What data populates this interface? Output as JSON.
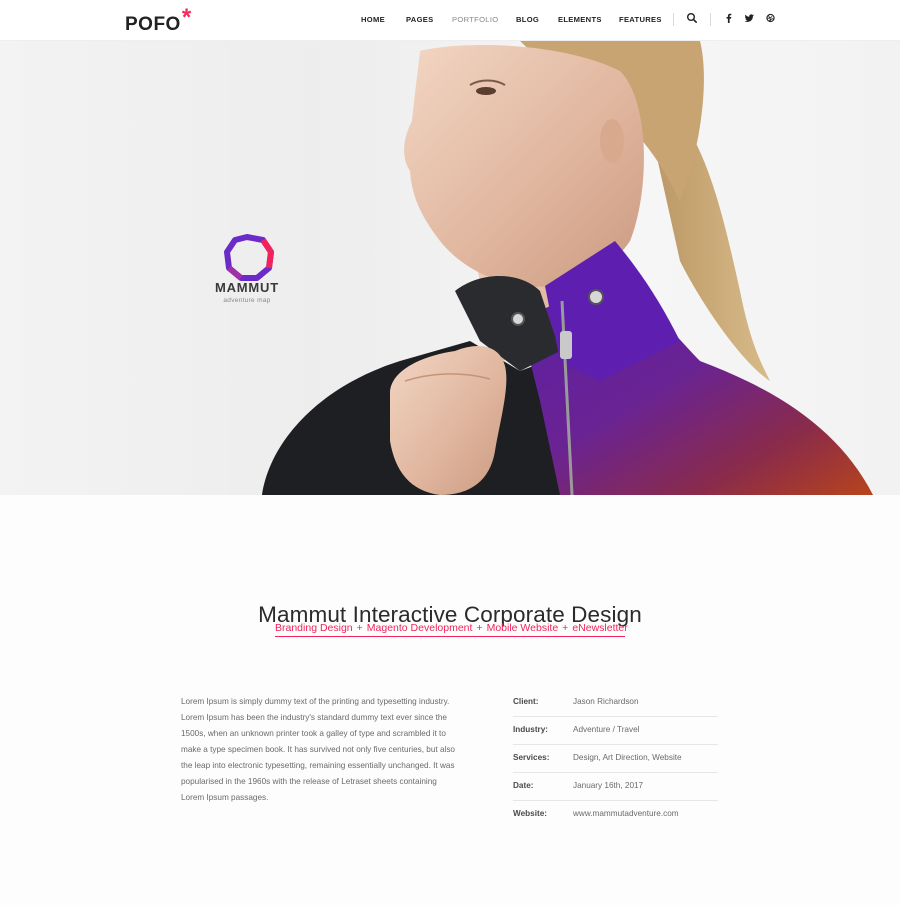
{
  "header": {
    "logo_text": "POFO",
    "logo_mark": "*",
    "nav": [
      {
        "label": "HOME",
        "active": false
      },
      {
        "label": "PAGES",
        "active": false
      },
      {
        "label": "PORTFOLIO",
        "active": true
      },
      {
        "label": "BLOG",
        "active": false
      },
      {
        "label": "ELEMENTS",
        "active": false
      },
      {
        "label": "FEATURES",
        "active": false
      }
    ],
    "icons": [
      "search-icon",
      "facebook-icon",
      "twitter-icon",
      "dribbble-icon"
    ]
  },
  "hero": {
    "brand_name": "MAMMUT",
    "brand_tagline": "adventure map"
  },
  "project": {
    "title": "Mammut Interactive Corporate Design",
    "tags": [
      "Branding Design",
      "Magento Development",
      "Mobile Website",
      "eNewsletter"
    ],
    "tag_separator": "+",
    "description": "Lorem Ipsum is simply dummy text of the printing and typesetting industry. Lorem Ipsum has been the industry's standard dummy text ever since the 1500s, when an unknown printer took a galley of type and scrambled it to make a type specimen book. It has survived not only five centuries, but also the leap into electronic typesetting, remaining essentially unchanged. It was popularised in the 1960s with the release of Letraset sheets containing Lorem Ipsum passages.",
    "meta": [
      {
        "label": "Client:",
        "value": "Jason Richardson"
      },
      {
        "label": "Industry:",
        "value": "Adventure / Travel"
      },
      {
        "label": "Services:",
        "value": "Design, Art Direction, Website"
      },
      {
        "label": "Date:",
        "value": "January 16th, 2017"
      },
      {
        "label": "Website:",
        "value": "www.mammutadventure.com"
      }
    ]
  },
  "colors": {
    "accent": "#f1245a",
    "text_dark": "#2b2b2b",
    "text_muted": "#6a6a6a"
  }
}
